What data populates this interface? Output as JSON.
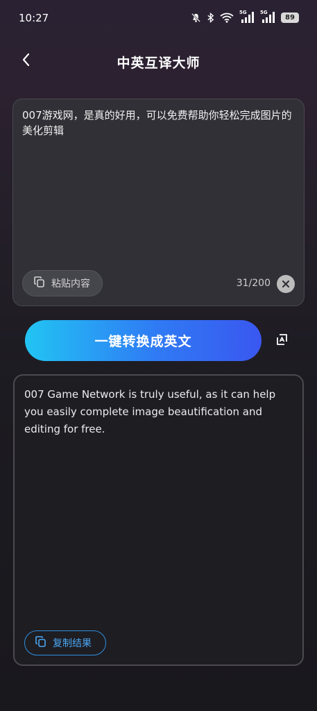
{
  "status_bar": {
    "time": "10:27",
    "signal_1_label": "5G",
    "signal_2_label": "5G",
    "battery": "89",
    "icons": [
      "bell-muted-icon",
      "bluetooth-icon",
      "wifi-icon",
      "signal-icon",
      "signal-icon",
      "battery-icon"
    ]
  },
  "header": {
    "title": "中英互译大师",
    "back_icon": "chevron-left-icon"
  },
  "input": {
    "text": "007游戏网，是真的好用，可以免费帮助你轻松完成图片的美化剪辑",
    "paste_label": "粘贴内容",
    "char_count": "31/200",
    "clear_icon": "close-icon"
  },
  "actions": {
    "convert_label": "一键转换成英文",
    "swap_icon": "swap-icon"
  },
  "output": {
    "text": "007 Game Network is truly useful, as it can help you easily complete image beautification and editing for free.",
    "copy_label": "复制结果"
  },
  "colors": {
    "accent_start": "#22c4f3",
    "accent_end": "#3a57f0",
    "copy_accent": "#2f8fe0"
  }
}
